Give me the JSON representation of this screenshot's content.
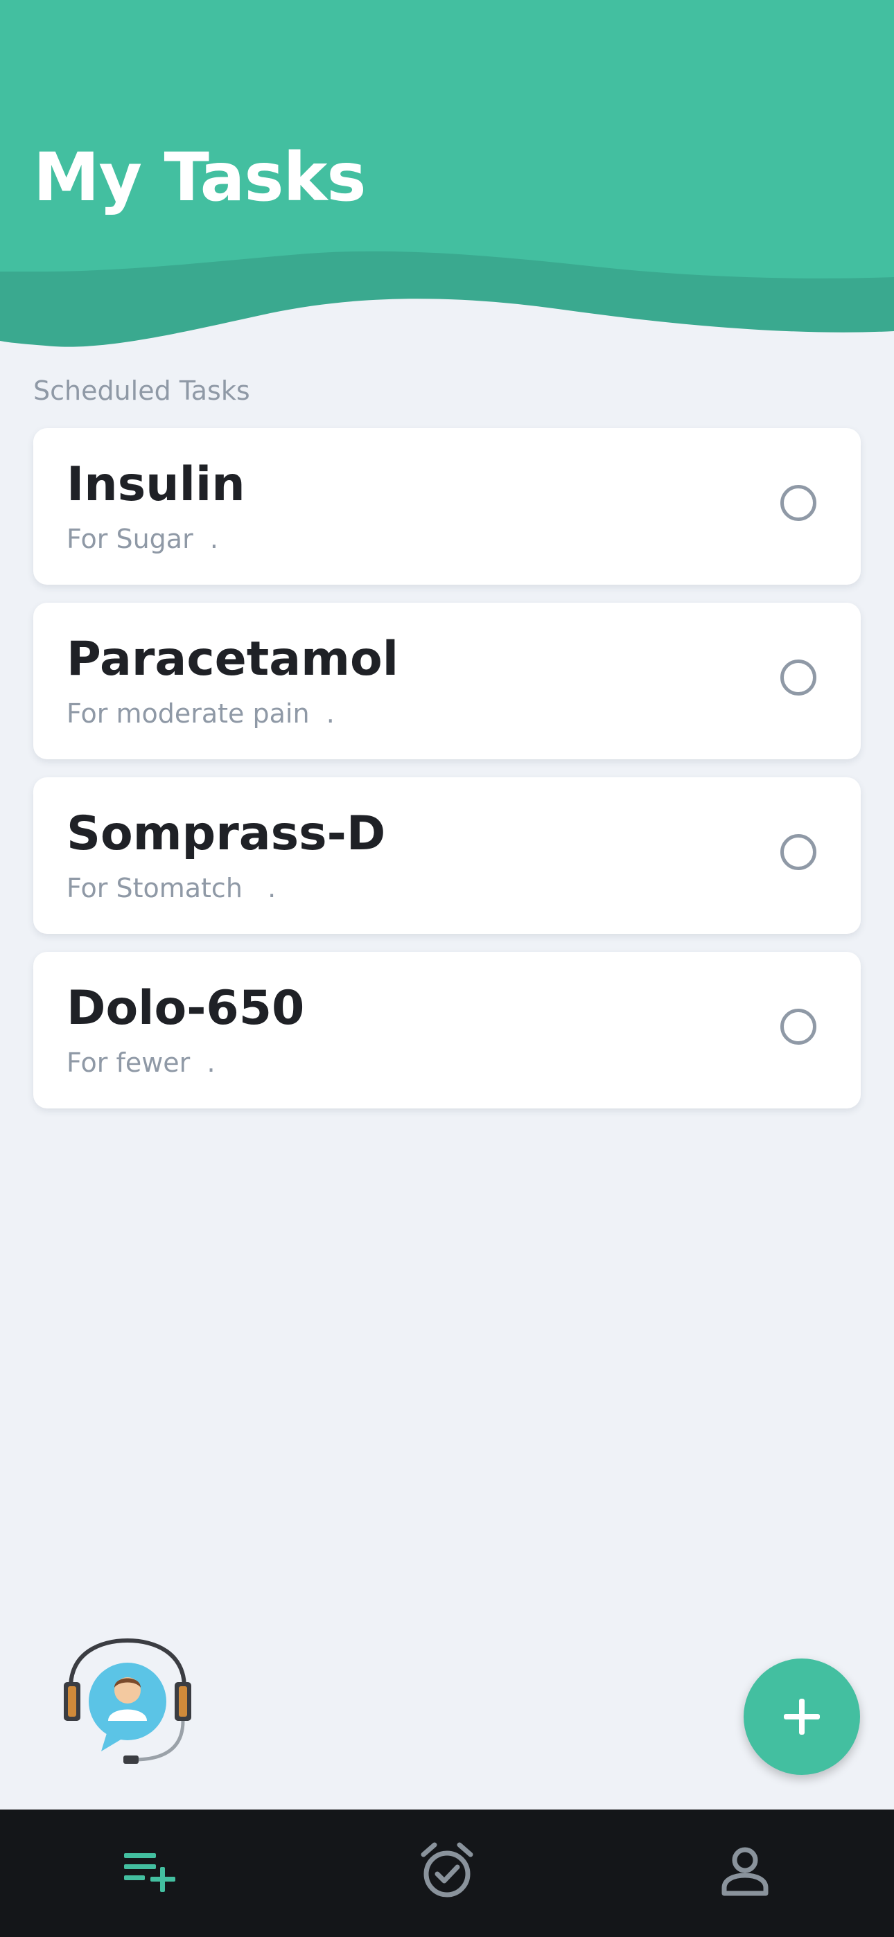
{
  "header": {
    "title": "My Tasks"
  },
  "section": {
    "label": "Scheduled Tasks"
  },
  "tasks": [
    {
      "name": "Insulin",
      "purpose": "For Sugar  ."
    },
    {
      "name": "Paracetamol",
      "purpose": "For moderate pain  ."
    },
    {
      "name": "Somprass-D",
      "purpose": "For Stomatch   ."
    },
    {
      "name": "Dolo-650",
      "purpose": "For fewer  ."
    }
  ],
  "colors": {
    "accent": "#43bfa0",
    "background": "#eff2f7",
    "nav_background": "#141619",
    "active_nav": "#43bfa0",
    "inactive_nav": "#8a939c"
  },
  "icons": {
    "support": "support-agent-icon",
    "add": "plus-icon",
    "nav_tasks": "add-task-list-icon",
    "nav_alarm": "alarm-check-icon",
    "nav_profile": "person-icon"
  },
  "bottom_nav": {
    "active": "tasks"
  }
}
